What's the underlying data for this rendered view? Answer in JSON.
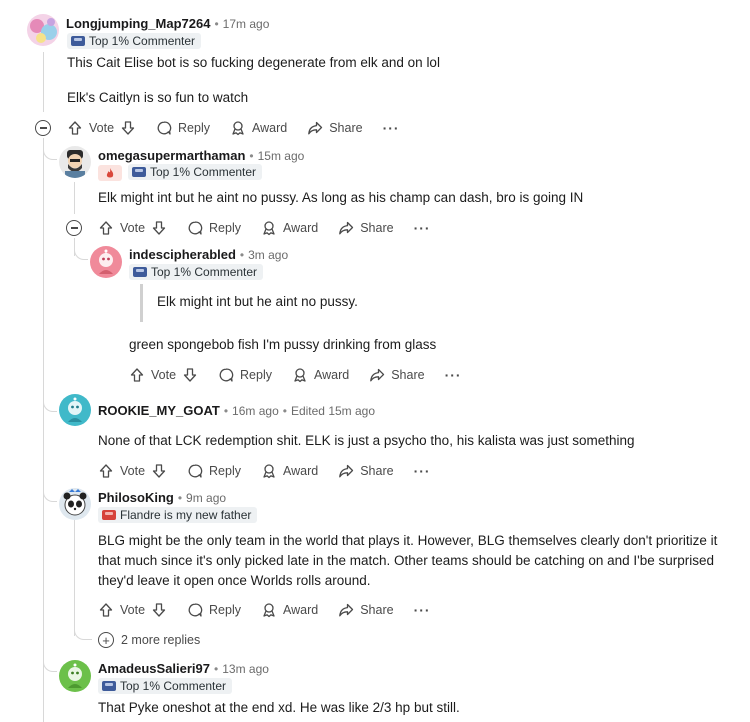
{
  "comments": [
    {
      "user": "Longjumping_Map7264",
      "time": "17m ago",
      "flair": "Top 1% Commenter",
      "paragraphs": [
        "This Cait Elise bot is so fucking degenerate from elk and on lol",
        "Elk's Caitlyn is so fun to watch"
      ],
      "actions": {
        "vote": "Vote",
        "reply": "Reply",
        "award": "Award",
        "share": "Share"
      }
    },
    {
      "user": "omegasupermarthaman",
      "time": "15m ago",
      "flair": "Top 1% Commenter",
      "paragraphs": [
        "Elk might int but he aint no pussy. As long as his champ can dash, bro is going IN"
      ],
      "actions": {
        "vote": "Vote",
        "reply": "Reply",
        "award": "Award",
        "share": "Share"
      }
    },
    {
      "user": "indescipherabled",
      "time": "3m ago",
      "flair": "Top 1% Commenter",
      "quote": "Elk might int but he aint no pussy.",
      "paragraphs": [
        "green spongebob fish I'm pussy drinking from glass"
      ],
      "actions": {
        "vote": "Vote",
        "reply": "Reply",
        "award": "Award",
        "share": "Share"
      }
    },
    {
      "user": "ROOKIE_MY_GOAT",
      "time": "16m ago",
      "edited": "Edited 15m ago",
      "paragraphs": [
        "None of that LCK redemption shit. ELK is just a psycho tho, his kalista was just something"
      ],
      "actions": {
        "vote": "Vote",
        "reply": "Reply",
        "award": "Award",
        "share": "Share"
      }
    },
    {
      "user": "PhilosoKing",
      "time": "9m ago",
      "flair": "Flandre is my new father",
      "paragraphs": [
        "BLG might be the only team in the world that plays it. However, BLG themselves clearly don't prioritize it that much since it's only picked late in the match. Other teams should be catching on and I'be surprised they'd leave it open once Worlds rolls around."
      ],
      "actions": {
        "vote": "Vote",
        "reply": "Reply",
        "award": "Award",
        "share": "Share"
      },
      "more_replies": "2 more replies"
    },
    {
      "user": "AmadeusSalieri97",
      "time": "13m ago",
      "flair": "Top 1% Commenter",
      "paragraphs": [
        "That Pyke oneshot at the end xd. He was like 2/3 hp but still."
      ]
    }
  ],
  "icons": {
    "upvote": "arrow-up-icon",
    "downvote": "arrow-down-icon",
    "reply": "speech-bubble-icon",
    "award": "award-icon",
    "share": "share-arrow-icon",
    "more": "ellipsis-icon",
    "collapse": "minus-circle-icon",
    "expand": "plus-circle-icon"
  },
  "colors": {
    "flair_bg": "#eef1f3",
    "thread_line": "#d8d8d8",
    "default_avatar_teal": "#40b9c9",
    "default_avatar_green": "#6cc04a",
    "default_avatar_pink": "#f08a9a"
  }
}
